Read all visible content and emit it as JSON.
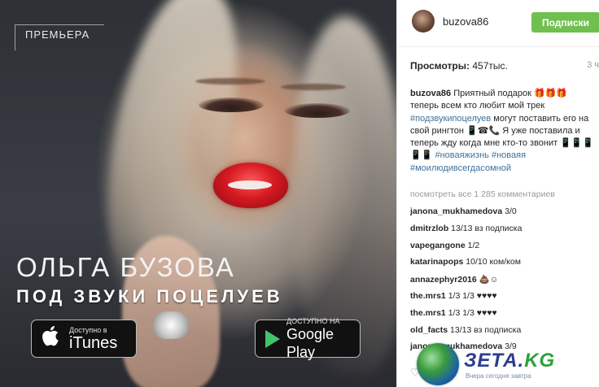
{
  "media": {
    "premiere_label": "ПРЕМЬЕРА",
    "artist": "ОЛЬГА БУЗОВА",
    "song": "ПОД ЗВУКИ ПОЦЕЛУЕВ",
    "itunes_badge": {
      "small": "Доступно в",
      "big": "iTunes"
    },
    "gplay_badge": {
      "small": "ДОСТУПНО НА",
      "big": "Google Play"
    }
  },
  "header": {
    "username": "buzova86",
    "follow_label": "Подписки"
  },
  "stats": {
    "views_label": "Просмотры:",
    "views_value": "457тыс.",
    "time_ago": "3 ч"
  },
  "caption": {
    "username": "buzova86",
    "text_1": " Приятный подарок 🎁🎁🎁 теперь всем кто любит мой трек ",
    "tag_1": "#подзвукипоцелуев",
    "text_2": " могут поставить его на свой рингтон 📱☎📞 Я уже поставила и теперь жду когда мне кто-то звонит 📱📱📱📱📱 ",
    "tag_2": "#новаяжизнь",
    "tag_3": "#новаяя",
    "tag_4": "#моилюдивсегдасомной"
  },
  "view_all_comments": "посмотреть все 1 285 комментариев",
  "comments": [
    {
      "user": "janona_mukhamedova",
      "text": " 3/0"
    },
    {
      "user": "dmitrzlob",
      "text": " 13/13 вз подписка"
    },
    {
      "user": "vapegangone",
      "text": " 1/2"
    },
    {
      "user": "katarinapops",
      "text": " 10/10 ком/ком"
    },
    {
      "user": "annazephyr2016",
      "text": " 💩☺"
    },
    {
      "user": "the.mrs1",
      "text": " 1/3 1/3 ♥♥♥♥"
    },
    {
      "user": "the.mrs1",
      "text": " 1/3 1/3 ♥♥♥♥"
    },
    {
      "user": "old_facts",
      "text": " 13/13 вз подписка"
    },
    {
      "user": "janona_mukhamedova",
      "text": " 3/9"
    }
  ],
  "watermark": {
    "brand": "ЗЕТА.",
    "brand_tld": "KG",
    "tagline": "Вчера сегодня завтра"
  },
  "colors": {
    "follow_green": "#70c050",
    "hashtag_blue": "#3f729b",
    "lip_red": "#d51a22"
  }
}
